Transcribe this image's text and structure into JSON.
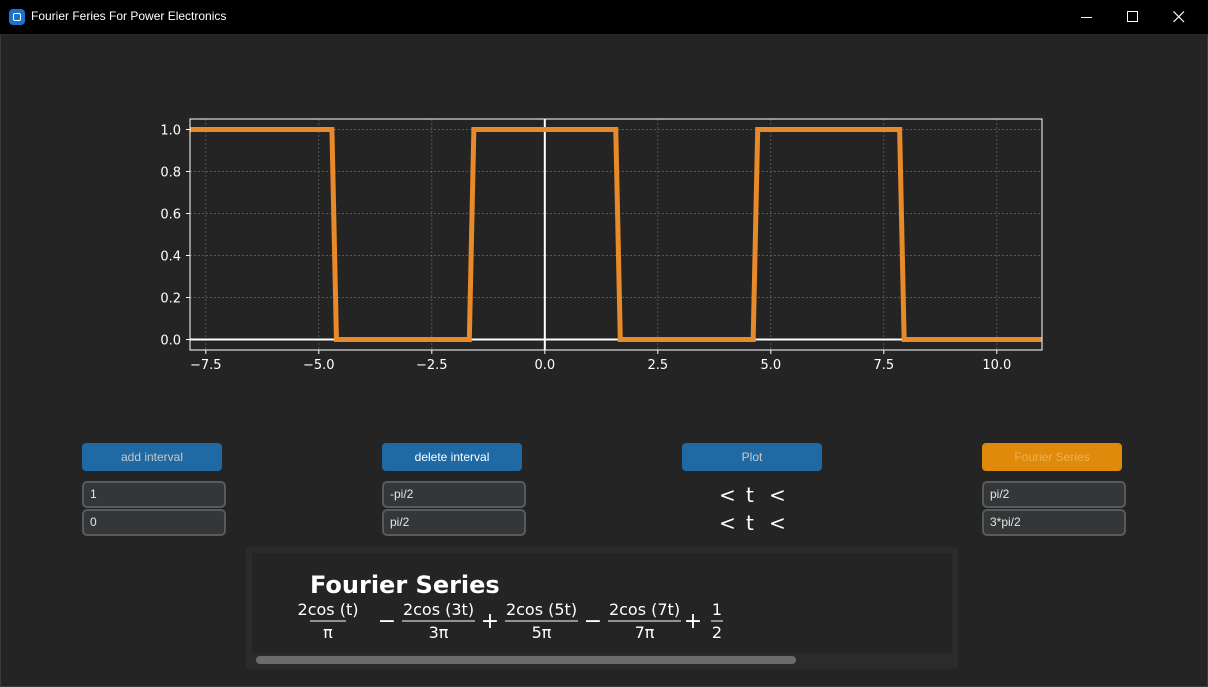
{
  "window": {
    "title": "Fourier Feries For Power Electronics",
    "minimize_symbol": "─",
    "maximize_symbol": "☐",
    "close_symbol": "✕"
  },
  "chart_data": {
    "type": "line",
    "title": "",
    "xlabel": "",
    "ylabel": "",
    "xlim": [
      -7.85,
      11.0
    ],
    "ylim": [
      -0.05,
      1.05
    ],
    "xticks": [
      -7.5,
      -5.0,
      -2.5,
      0.0,
      2.5,
      5.0,
      7.5,
      10.0
    ],
    "xtick_labels": [
      "−7.5",
      "−5.0",
      "−2.5",
      "0.0",
      "2.5",
      "5.0",
      "7.5",
      "10.0"
    ],
    "yticks": [
      0.0,
      0.2,
      0.4,
      0.6,
      0.8,
      1.0
    ],
    "ytick_labels": [
      "0.0",
      "0.2",
      "0.4",
      "0.6",
      "0.8",
      "1.0"
    ],
    "grid": true,
    "series": [
      {
        "color": "#e8892a",
        "x": [
          -7.85,
          -4.71,
          -4.61,
          -1.67,
          -1.57,
          1.57,
          1.67,
          4.61,
          4.71,
          7.85,
          7.95,
          11.0
        ],
        "y": [
          1,
          1,
          0,
          0,
          1,
          1,
          0,
          0,
          1,
          1,
          0,
          0
        ]
      }
    ],
    "axis_lines": {
      "x_zero": true,
      "y_zero": true,
      "color": "#ffffff"
    }
  },
  "controls": {
    "add_interval_label": "add interval",
    "delete_interval_label": "delete interval",
    "plot_label": "Plot",
    "fourier_series_label": "Fourier Series",
    "values": [
      "1",
      "0"
    ],
    "lower_bounds": [
      "-pi/2",
      "pi/2"
    ],
    "upper_bounds": [
      "pi/2",
      "3*pi/2"
    ],
    "inequality_rows": [
      "<",
      "t",
      "<"
    ]
  },
  "result": {
    "heading": "Fourier Series",
    "terms": [
      {
        "sign": "",
        "numer": "2cos (t)",
        "denom": "π"
      },
      {
        "sign": "−",
        "numer": "2cos (3t)",
        "denom": "3π"
      },
      {
        "sign": "+",
        "numer": "2cos (5t)",
        "denom": "5π"
      },
      {
        "sign": "−",
        "numer": "2cos (7t)",
        "denom": "7π"
      },
      {
        "sign": "+",
        "numer": "1",
        "denom": "2"
      }
    ]
  },
  "colors": {
    "background": "#242424",
    "titlebar": "#000000",
    "blue_button": "#1f6aa5",
    "orange_button": "#e08a0b",
    "plot_line": "#e8892a"
  }
}
